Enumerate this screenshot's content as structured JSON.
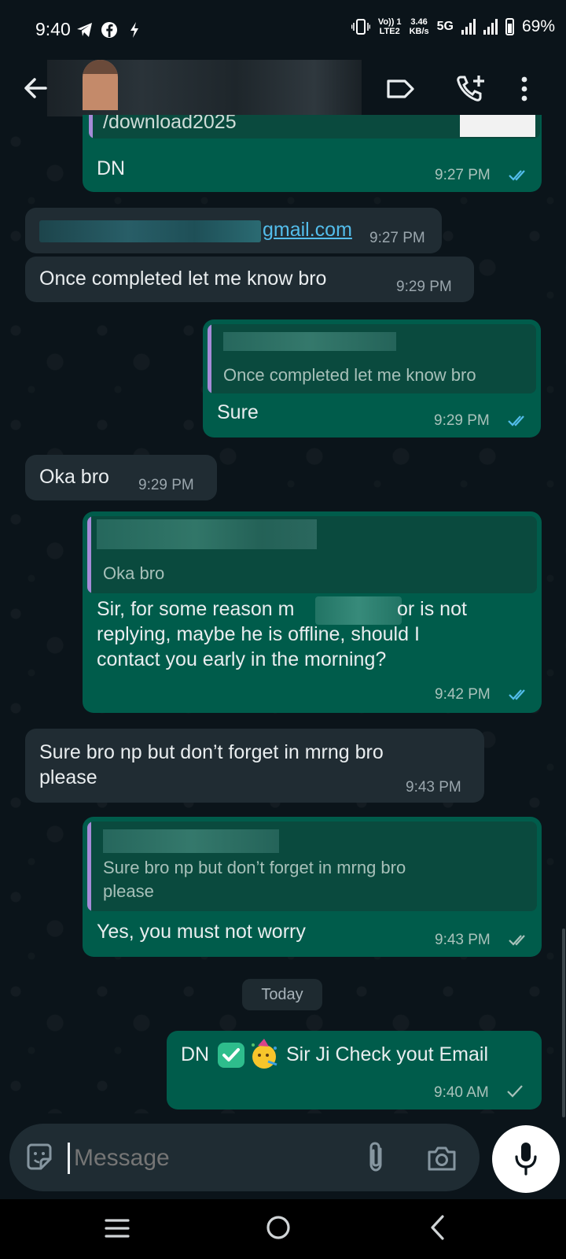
{
  "status_bar": {
    "time": "9:40",
    "net_top": "Vo)) 1",
    "net_bottom": "LTE2",
    "speed_top": "3.46",
    "speed_bottom": "KB/s",
    "network": "5G",
    "battery": "69%"
  },
  "header": {
    "icons": [
      "back-arrow-icon",
      "label-icon",
      "add-call-icon",
      "more-vertical-icon"
    ]
  },
  "messages": [
    {
      "dir": "out",
      "text": "DN",
      "partial_top": "/download2025",
      "time": "9:27 PM",
      "ticks": "read"
    },
    {
      "dir": "in",
      "text": "gmail.com",
      "time": "9:27 PM"
    },
    {
      "dir": "in",
      "text": "Once completed let me know bro",
      "time": "9:29 PM"
    },
    {
      "dir": "out",
      "quote": "Once completed let me know bro",
      "text": "Sure",
      "time": "9:29 PM",
      "ticks": "read"
    },
    {
      "dir": "in",
      "text": "Oka bro",
      "time": "9:29 PM"
    },
    {
      "dir": "out",
      "quote": "Oka bro",
      "text_a": "Sir, for some reason m",
      "text_b": "or is not",
      "text_c": "replying, maybe he is offline, should I",
      "text_d": "contact you early in the morning?",
      "time": "9:42 PM",
      "ticks": "read"
    },
    {
      "dir": "in",
      "text_a": "Sure bro np but don’t forget in mrng bro",
      "text_b": "please",
      "time": "9:43 PM"
    },
    {
      "dir": "out",
      "quote_a": "Sure bro np but don’t forget in mrng bro",
      "quote_b": "please",
      "text": "Yes, you must not worry",
      "time": "9:43 PM",
      "ticks": "delivered"
    },
    {
      "dir": "out",
      "text_a": "DN",
      "text_b": "Sir Ji Check yout Email",
      "time": "9:40 AM",
      "ticks": "sent"
    }
  ],
  "date_divider": "Today",
  "composer": {
    "placeholder": "Message"
  },
  "colors": {
    "background": "#0b141a",
    "outgoing_bubble": "#005c4b",
    "incoming_bubble": "#202c33",
    "read_tick": "#53bdeb",
    "link": "#53bdeb"
  }
}
